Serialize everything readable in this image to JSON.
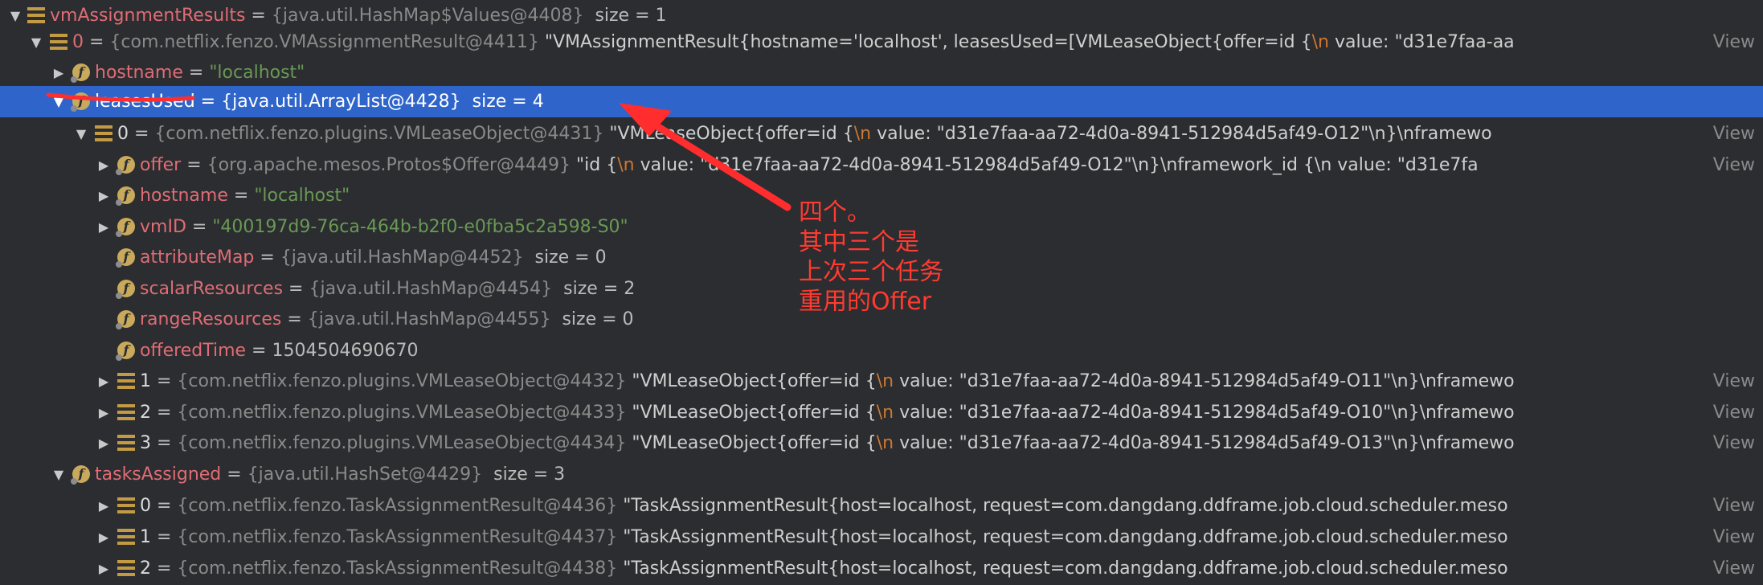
{
  "rows": [
    {
      "name": "vmAssignmentResults",
      "eq": " = ",
      "ref": "{java.util.HashMap$Values@4408}",
      "size": "size = 1"
    },
    {
      "name": "0",
      "eq": " = ",
      "ref": "{com.netflix.fenzo.VMAssignmentResult@4411}",
      "value": "\"VMAssignmentResult{hostname='localhost', leasesUsed=[VMLeaseObject{offer=id {",
      "value_kw": "\\n",
      "value_tail": "  value: \"d31e7faa-aa",
      "view": "View"
    },
    {
      "name": "hostname",
      "eq": " = ",
      "str": "\"localhost\""
    },
    {
      "name": "leasesUsed",
      "eq": " = ",
      "ref": "{java.util.ArrayList@4428}",
      "size": "size = 4"
    },
    {
      "name": "0",
      "eq": " = ",
      "ref": "{com.netflix.fenzo.plugins.VMLeaseObject@4431}",
      "value": "\"VMLeaseObject{offer=id {",
      "value_kw": "\\n",
      "value_tail": "  value: \"d31e7faa-aa72-4d0a-8941-512984d5af49-O12\"\\n}\\nframewo",
      "view": "View"
    },
    {
      "name": "offer",
      "eq": " = ",
      "ref": "{org.apache.mesos.Protos$Offer@4449}",
      "value": "\"id {",
      "value_kw": "\\n",
      "value_tail": "  value: \"d31e7faa-aa72-4d0a-8941-512984d5af49-O12\"\\n}\\nframework_id {\\n  value: \"d31e7fa",
      "view": "View"
    },
    {
      "name": "hostname",
      "eq": " = ",
      "str": "\"localhost\""
    },
    {
      "name": "vmID",
      "eq": " = ",
      "str": "\"400197d9-76ca-464b-b2f0-e0fba5c2a598-S0\""
    },
    {
      "name": "attributeMap",
      "eq": " = ",
      "ref": "{java.util.HashMap@4452}",
      "size": "size = 0"
    },
    {
      "name": "scalarResources",
      "eq": " = ",
      "ref": "{java.util.HashMap@4454}",
      "size": "size = 2"
    },
    {
      "name": "rangeResources",
      "eq": " = ",
      "ref": "{java.util.HashMap@4455}",
      "size": "size = 0"
    },
    {
      "name": "offeredTime",
      "eq": " = ",
      "num": "1504504690670"
    },
    {
      "name": "1",
      "eq": " = ",
      "ref": "{com.netflix.fenzo.plugins.VMLeaseObject@4432}",
      "value": "\"VMLeaseObject{offer=id {",
      "value_kw": "\\n",
      "value_tail": "  value: \"d31e7faa-aa72-4d0a-8941-512984d5af49-O11\"\\n}\\nframewo",
      "view": "View"
    },
    {
      "name": "2",
      "eq": " = ",
      "ref": "{com.netflix.fenzo.plugins.VMLeaseObject@4433}",
      "value": "\"VMLeaseObject{offer=id {",
      "value_kw": "\\n",
      "value_tail": "  value: \"d31e7faa-aa72-4d0a-8941-512984d5af49-O10\"\\n}\\nframewo",
      "view": "View"
    },
    {
      "name": "3",
      "eq": " = ",
      "ref": "{com.netflix.fenzo.plugins.VMLeaseObject@4434}",
      "value": "\"VMLeaseObject{offer=id {",
      "value_kw": "\\n",
      "value_tail": "  value: \"d31e7faa-aa72-4d0a-8941-512984d5af49-O13\"\\n}\\nframewo",
      "view": "View"
    },
    {
      "name": "tasksAssigned",
      "eq": " = ",
      "ref": "{java.util.HashSet@4429}",
      "size": "size = 3"
    },
    {
      "name": "0",
      "eq": " = ",
      "ref": "{com.netflix.fenzo.TaskAssignmentResult@4436}",
      "value": "\"TaskAssignmentResult{host=localhost, request=com.dangdang.ddframe.job.cloud.scheduler.meso",
      "view": "View"
    },
    {
      "name": "1",
      "eq": " = ",
      "ref": "{com.netflix.fenzo.TaskAssignmentResult@4437}",
      "value": "\"TaskAssignmentResult{host=localhost, request=com.dangdang.ddframe.job.cloud.scheduler.meso",
      "view": "View"
    },
    {
      "name": "2",
      "eq": " = ",
      "ref": "{com.netflix.fenzo.TaskAssignmentResult@4438}",
      "value": "\"TaskAssignmentResult{host=localhost, request=com.dangdang.ddframe.job.cloud.scheduler.meso",
      "view": "View"
    }
  ],
  "annotation": {
    "lines": [
      "四个。",
      "其中三个是",
      "上次三个任务",
      "重用的Offer"
    ]
  },
  "colors": {
    "background": "#2b2d30",
    "selection": "#2f65ca",
    "annotation": "#ff3b30",
    "field_name": "#e06c75",
    "string": "#6a9955",
    "reference": "#8a8a8a",
    "icon": "#c49a42"
  },
  "icons": [
    "chevron-down-icon",
    "chevron-right-icon",
    "list-icon",
    "field-icon"
  ]
}
